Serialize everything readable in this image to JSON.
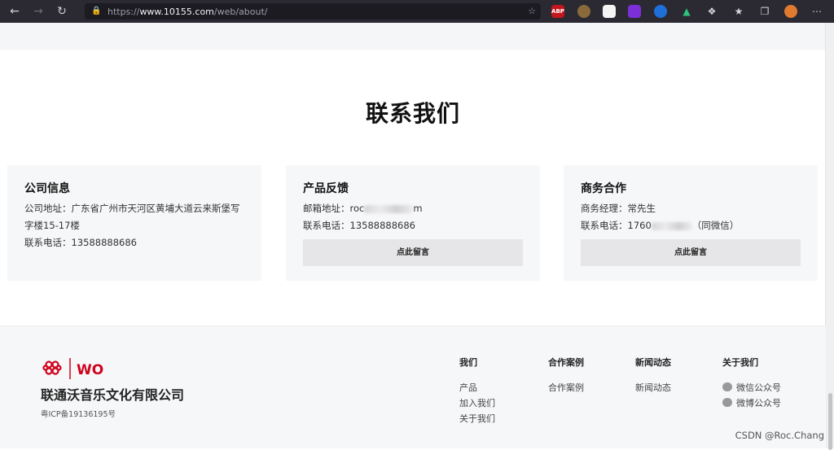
{
  "browser": {
    "url_prefix": "https://",
    "url_host": "www.10155.com",
    "url_path": "/web/about/",
    "extensions": [
      "ABP",
      "monkey-ext",
      "lemon-ext",
      "purple-ext",
      "circle-ext",
      "triangle-ext"
    ],
    "icons": [
      "back-icon",
      "forward-icon",
      "reload-icon",
      "lock-icon",
      "bookmark-star-icon",
      "extensions-puzzle-icon",
      "favorites-icon",
      "collections-icon",
      "profile-avatar"
    ]
  },
  "contact": {
    "title": "联系我们",
    "cards": [
      {
        "title": "公司信息",
        "address": "公司地址：广东省广州市天河区黄埔大道云来斯堡写字楼15-17楼",
        "phone": "联系电话：13588888686"
      },
      {
        "title": "产品反馈",
        "email_prefix": "邮箱地址：roc",
        "email_suffix": "m",
        "phone": "联系电话：13588888686",
        "button": "点此留言"
      },
      {
        "title": "商务合作",
        "manager": "商务经理：常先生",
        "phone_prefix": "联系电话：1760",
        "phone_suffix": "（同微信）",
        "button": "点此留言"
      }
    ]
  },
  "footer": {
    "logo_text": "WO",
    "company": "联通沃音乐文化有限公司",
    "icp": "粤ICP备19136195号",
    "columns": [
      {
        "heading": "我们",
        "items": [
          "产品",
          "加入我们",
          "关于我们"
        ]
      },
      {
        "heading": "合作案例",
        "items": [
          "合作案例"
        ]
      },
      {
        "heading": "新闻动态",
        "items": [
          "新闻动态"
        ]
      },
      {
        "heading": "关于我们",
        "items": [
          "微信公众号",
          "微博公众号"
        ]
      }
    ]
  },
  "watermark": "CSDN @Roc.Chang",
  "colors": {
    "brand_red": "#d0021b",
    "chrome_bg": "#2b2a33"
  }
}
